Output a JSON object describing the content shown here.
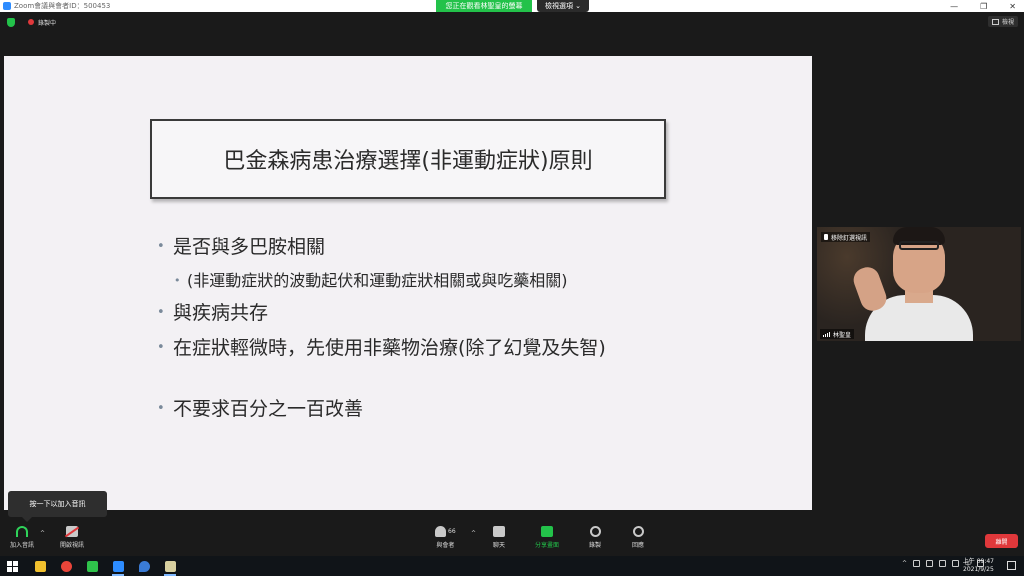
{
  "window": {
    "title": "Zoom會議與會者ID：500453",
    "share_banner": "您正在觀看林聖皇的螢幕",
    "view_options": "檢視選項 ⌄",
    "controls": [
      "—",
      "❐",
      "✕"
    ]
  },
  "status": {
    "recording": "錄製中",
    "view_button": "檢視"
  },
  "slide": {
    "title": "巴金森病患治療選擇(非運動症狀)原則",
    "bullets": [
      "是否與多巴胺相關",
      "(非運動症狀的波動起伏和運動症狀相關或與吃藥相關)",
      "與疾病共存",
      "在症狀輕微時，先使用非藥物治療(除了幻覺及失智)",
      "不要求百分之一百改善"
    ],
    "bullet_glyph": "•",
    "background": "#f3f1f4"
  },
  "video": {
    "pin_label": "移除釘選視訊",
    "name_label": "林聖皇"
  },
  "tooltip": {
    "text": "按一下以加入音訊"
  },
  "toolbar": {
    "join_audio": "加入音訊",
    "start_video": "開啟視訊",
    "participants": "與會者",
    "participants_count": "66",
    "chat": "聊天",
    "share_screen": "分享畫面",
    "record": "錄製",
    "reactions": "回應",
    "leave": "離開",
    "caret": "^"
  },
  "taskbar": {
    "tray_language": "中",
    "time": "上午 09:47",
    "date": "2021/9/25"
  },
  "colors": {
    "accent_green": "#23c24a",
    "danger_red": "#e0383b",
    "zoom_blue": "#2d8cff"
  }
}
